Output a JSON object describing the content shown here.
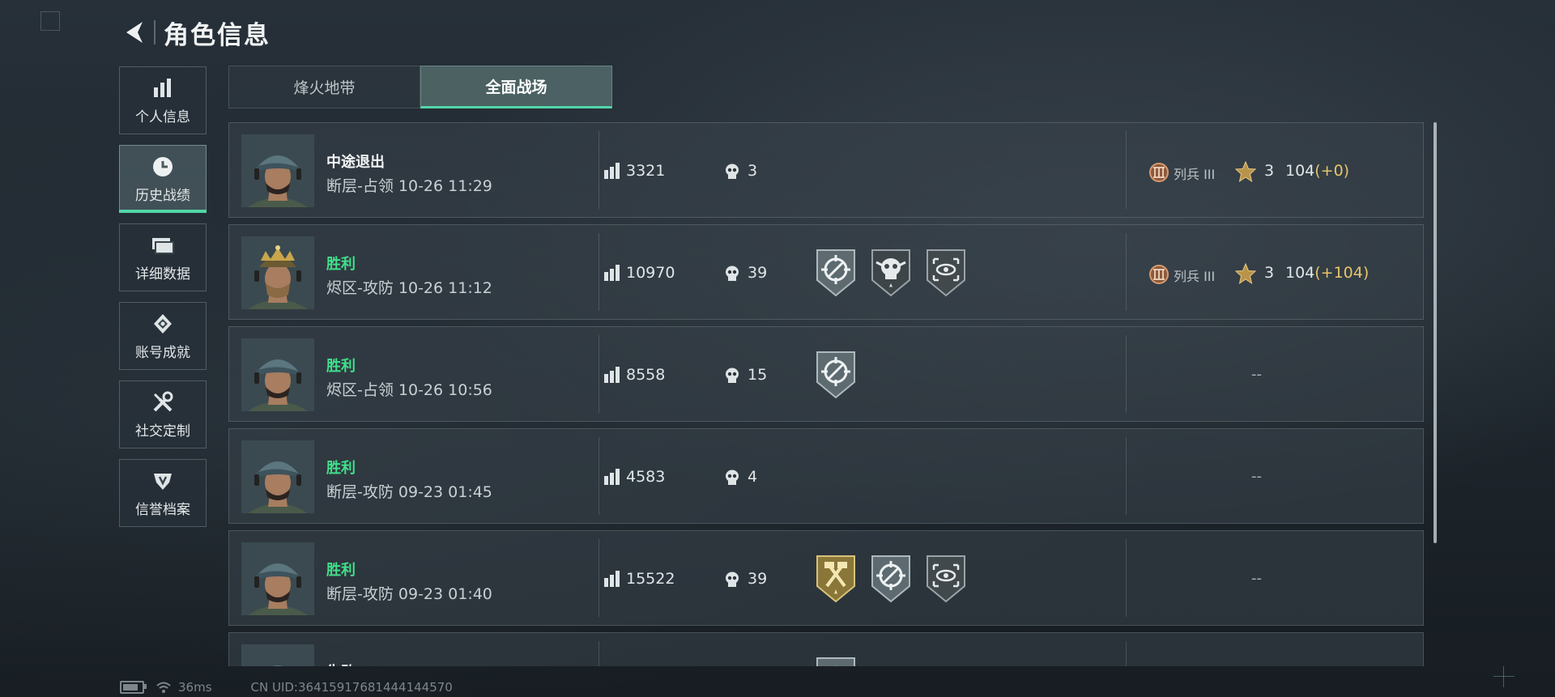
{
  "header": {
    "title": "角色信息"
  },
  "sidebar": {
    "items": [
      {
        "label": "个人信息",
        "icon": "bar-chart-icon"
      },
      {
        "label": "历史战绩",
        "icon": "clock-icon",
        "active": true
      },
      {
        "label": "详细数据",
        "icon": "cards-icon"
      },
      {
        "label": "账号成就",
        "icon": "medal-icon"
      },
      {
        "label": "社交定制",
        "icon": "tools-icon"
      },
      {
        "label": "信誉档案",
        "icon": "shield-icon"
      }
    ]
  },
  "tabs": [
    {
      "label": "烽火地带",
      "active": false
    },
    {
      "label": "全面战场",
      "active": true
    }
  ],
  "records": [
    {
      "result": "中途退出",
      "win": false,
      "map_mode_time": "断层-占领 10-26 11:29",
      "score": "3321",
      "kills": "3",
      "badges": [],
      "rank": "列兵 III",
      "stars": "3",
      "points": "104",
      "delta": "(+0)",
      "avatar_style": "cap"
    },
    {
      "result": "胜利",
      "win": true,
      "map_mode_time": "烬区-攻防 10-26 11:12",
      "score": "10970",
      "kills": "39",
      "badges": [
        "crosshair-badge",
        "skull-badge",
        "eye-target-badge"
      ],
      "rank": "列兵 III",
      "stars": "3",
      "points": "104",
      "delta": "(+104)",
      "avatar_style": "crown"
    },
    {
      "result": "胜利",
      "win": true,
      "map_mode_time": "烬区-占领 10-26 10:56",
      "score": "8558",
      "kills": "15",
      "badges": [
        "crosshair-badge"
      ],
      "rank_empty": "--",
      "avatar_style": "cap"
    },
    {
      "result": "胜利",
      "win": true,
      "map_mode_time": "断层-攻防 09-23 01:45",
      "score": "4583",
      "kills": "4",
      "badges": [],
      "rank_empty": "--",
      "avatar_style": "cap"
    },
    {
      "result": "胜利",
      "win": true,
      "map_mode_time": "断层-攻防 09-23 01:40",
      "score": "15522",
      "kills": "39",
      "badges": [
        "gold-hammer-badge",
        "crosshair-badge",
        "eye-target-badge"
      ],
      "rank_empty": "--",
      "avatar_style": "cap"
    },
    {
      "result": "失败",
      "win": false,
      "map_mode_time": "",
      "score": "",
      "kills": "",
      "badges": [
        "star-badge"
      ],
      "rank_empty": "--",
      "avatar_style": "cap"
    }
  ],
  "footer": {
    "ping": "36ms",
    "uid": "CN UID:36415917681444144570"
  },
  "colors": {
    "accent": "#52d6a8",
    "win": "#3fe08a",
    "delta": "#e6c56a",
    "gold_badge": "#b59a4a"
  }
}
